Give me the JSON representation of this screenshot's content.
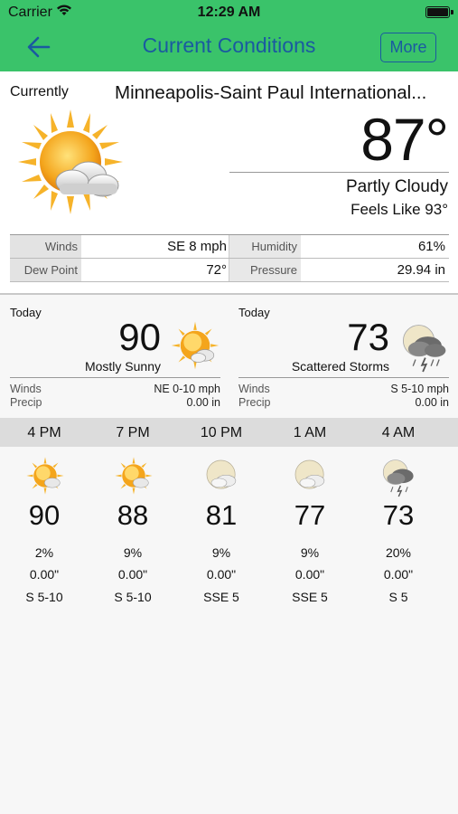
{
  "status": {
    "carrier": "Carrier",
    "time": "12:29 AM"
  },
  "nav": {
    "title": "Current Conditions",
    "more_label": "More",
    "back_icon": "arrow-left-icon"
  },
  "current": {
    "label": "Currently",
    "location": "Minneapolis-Saint Paul International...",
    "temp": "87°",
    "condition": "Partly Cloudy",
    "feels_like": "Feels Like 93°",
    "icon": "partly-cloudy-icon",
    "stats": {
      "winds_label": "Winds",
      "winds": "SE 8 mph",
      "humidity_label": "Humidity",
      "humidity": "61%",
      "dewpoint_label": "Dew Point",
      "dewpoint": "72°",
      "pressure_label": "Pressure",
      "pressure": "29.94 in"
    }
  },
  "forecast": [
    {
      "day": "Today",
      "temp": "90",
      "desc": "Mostly Sunny",
      "icon": "mostly-sunny-icon",
      "winds_label": "Winds",
      "winds": "NE 0-10 mph",
      "precip_label": "Precip",
      "precip": "0.00 in"
    },
    {
      "day": "Today",
      "temp": "73",
      "desc": "Scattered Storms",
      "icon": "scattered-storms-icon",
      "winds_label": "Winds",
      "winds": "S 5-10 mph",
      "precip_label": "Precip",
      "precip": "0.00 in"
    }
  ],
  "hourly": [
    {
      "time": "4 PM",
      "icon": "mostly-sunny-icon",
      "temp": "90",
      "pop": "2%",
      "qpf": "0.00\"",
      "wind": "S 5-10"
    },
    {
      "time": "7 PM",
      "icon": "mostly-sunny-icon",
      "temp": "88",
      "pop": "9%",
      "qpf": "0.00\"",
      "wind": "S 5-10"
    },
    {
      "time": "10 PM",
      "icon": "partly-cloudy-night-icon",
      "temp": "81",
      "pop": "9%",
      "qpf": "0.00\"",
      "wind": "SSE 5"
    },
    {
      "time": "1 AM",
      "icon": "partly-cloudy-night-icon",
      "temp": "77",
      "pop": "9%",
      "qpf": "0.00\"",
      "wind": "SSE 5"
    },
    {
      "time": "4 AM",
      "icon": "storm-night-icon",
      "temp": "73",
      "pop": "20%",
      "qpf": "0.00\"",
      "wind": "S 5"
    }
  ],
  "colors": {
    "nav_bg": "#3ac36a",
    "nav_text": "#1a5aa0"
  }
}
